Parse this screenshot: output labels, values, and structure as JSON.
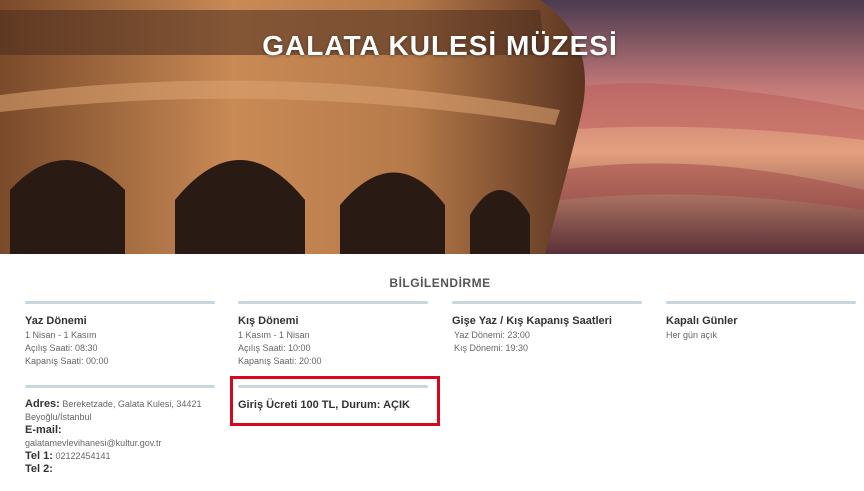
{
  "hero": {
    "title": "GALATA KULESİ MÜZESİ"
  },
  "section": {
    "title": "BİLGİLENDİRME"
  },
  "cards": [
    {
      "heading": "Yaz Dönemi",
      "lines": [
        "1 Nisan - 1 Kasım",
        "Açılış Saati: 08:30",
        "Kapanış Saati: 00:00"
      ]
    },
    {
      "heading": "Kış Dönemi",
      "lines": [
        "1 Kasım - 1 Nisan",
        "Açılış Saati: 10:00",
        "Kapanış Saati: 20:00"
      ]
    },
    {
      "heading": "Gişe Yaz / Kış Kapanış Saatleri",
      "lines": [
        "Yaz Dönemi: 23:00",
        "Kış Dönemi: 19:30"
      ]
    },
    {
      "heading": "Kapalı Günler",
      "lines": [
        "Her gün açık"
      ]
    }
  ],
  "address": {
    "label": "Adres:",
    "value": "Bereketzade, Galata Kulesi, 34421 Beyoğlu/İstanbul",
    "email_label": "E-mail:",
    "email_value": "galatamevlevihanesi@kultur.gov.tr",
    "tel1_label": "Tel 1:",
    "tel1_value": "02122454141",
    "tel2_label": "Tel 2:",
    "tel2_value": ""
  },
  "fee": {
    "text": "Giriş Ücreti 100 TL, Durum: AÇIK"
  },
  "colors": {
    "highlight": "#d9061f",
    "divider": "#c9d6dd"
  }
}
